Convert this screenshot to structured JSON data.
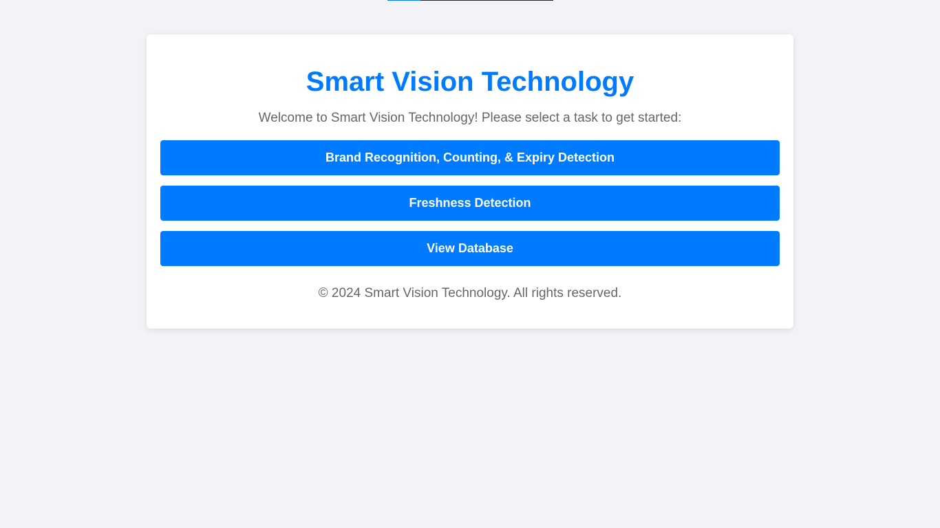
{
  "app": {
    "title": "Smart Vision Technology",
    "welcome": "Welcome to Smart Vision Technology! Please select a task to get started:",
    "footer": "© 2024 Smart Vision Technology. All rights reserved."
  },
  "tasks": [
    {
      "label": "Brand Recognition, Counting, & Expiry Detection"
    },
    {
      "label": "Freshness Detection"
    },
    {
      "label": "View Database"
    }
  ],
  "colors": {
    "accent": "#007bff",
    "background": "#f3f3f7",
    "card": "#ffffff",
    "muted_text": "#666666"
  }
}
